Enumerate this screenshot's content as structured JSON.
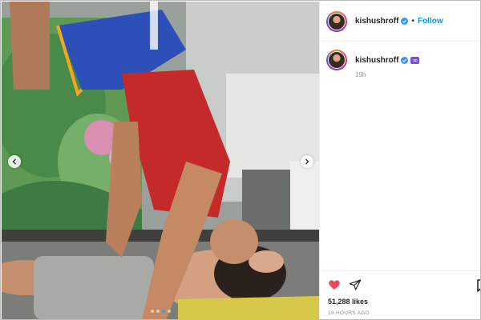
{
  "post": {
    "username": "kishushroff",
    "follow_label": "Follow",
    "separator": "•",
    "caption_badge": "∞",
    "caption_time": "19h",
    "likes": "51,288 likes",
    "posted_ago": "19 HOURS AGO",
    "carousel": {
      "slide_count": 4,
      "active_slide": 3
    }
  },
  "colors": {
    "follow_blue": "#0095f6",
    "like_red": "#ed4956",
    "verified_blue": "#3897f0",
    "infinity_badge": "#7d4cdb"
  },
  "icons": {
    "like": "heart-icon",
    "share": "paper-plane-icon",
    "save": "bookmark-icon",
    "prev": "chevron-left-icon",
    "next": "chevron-right-icon",
    "verified": "verified-badge-icon"
  }
}
